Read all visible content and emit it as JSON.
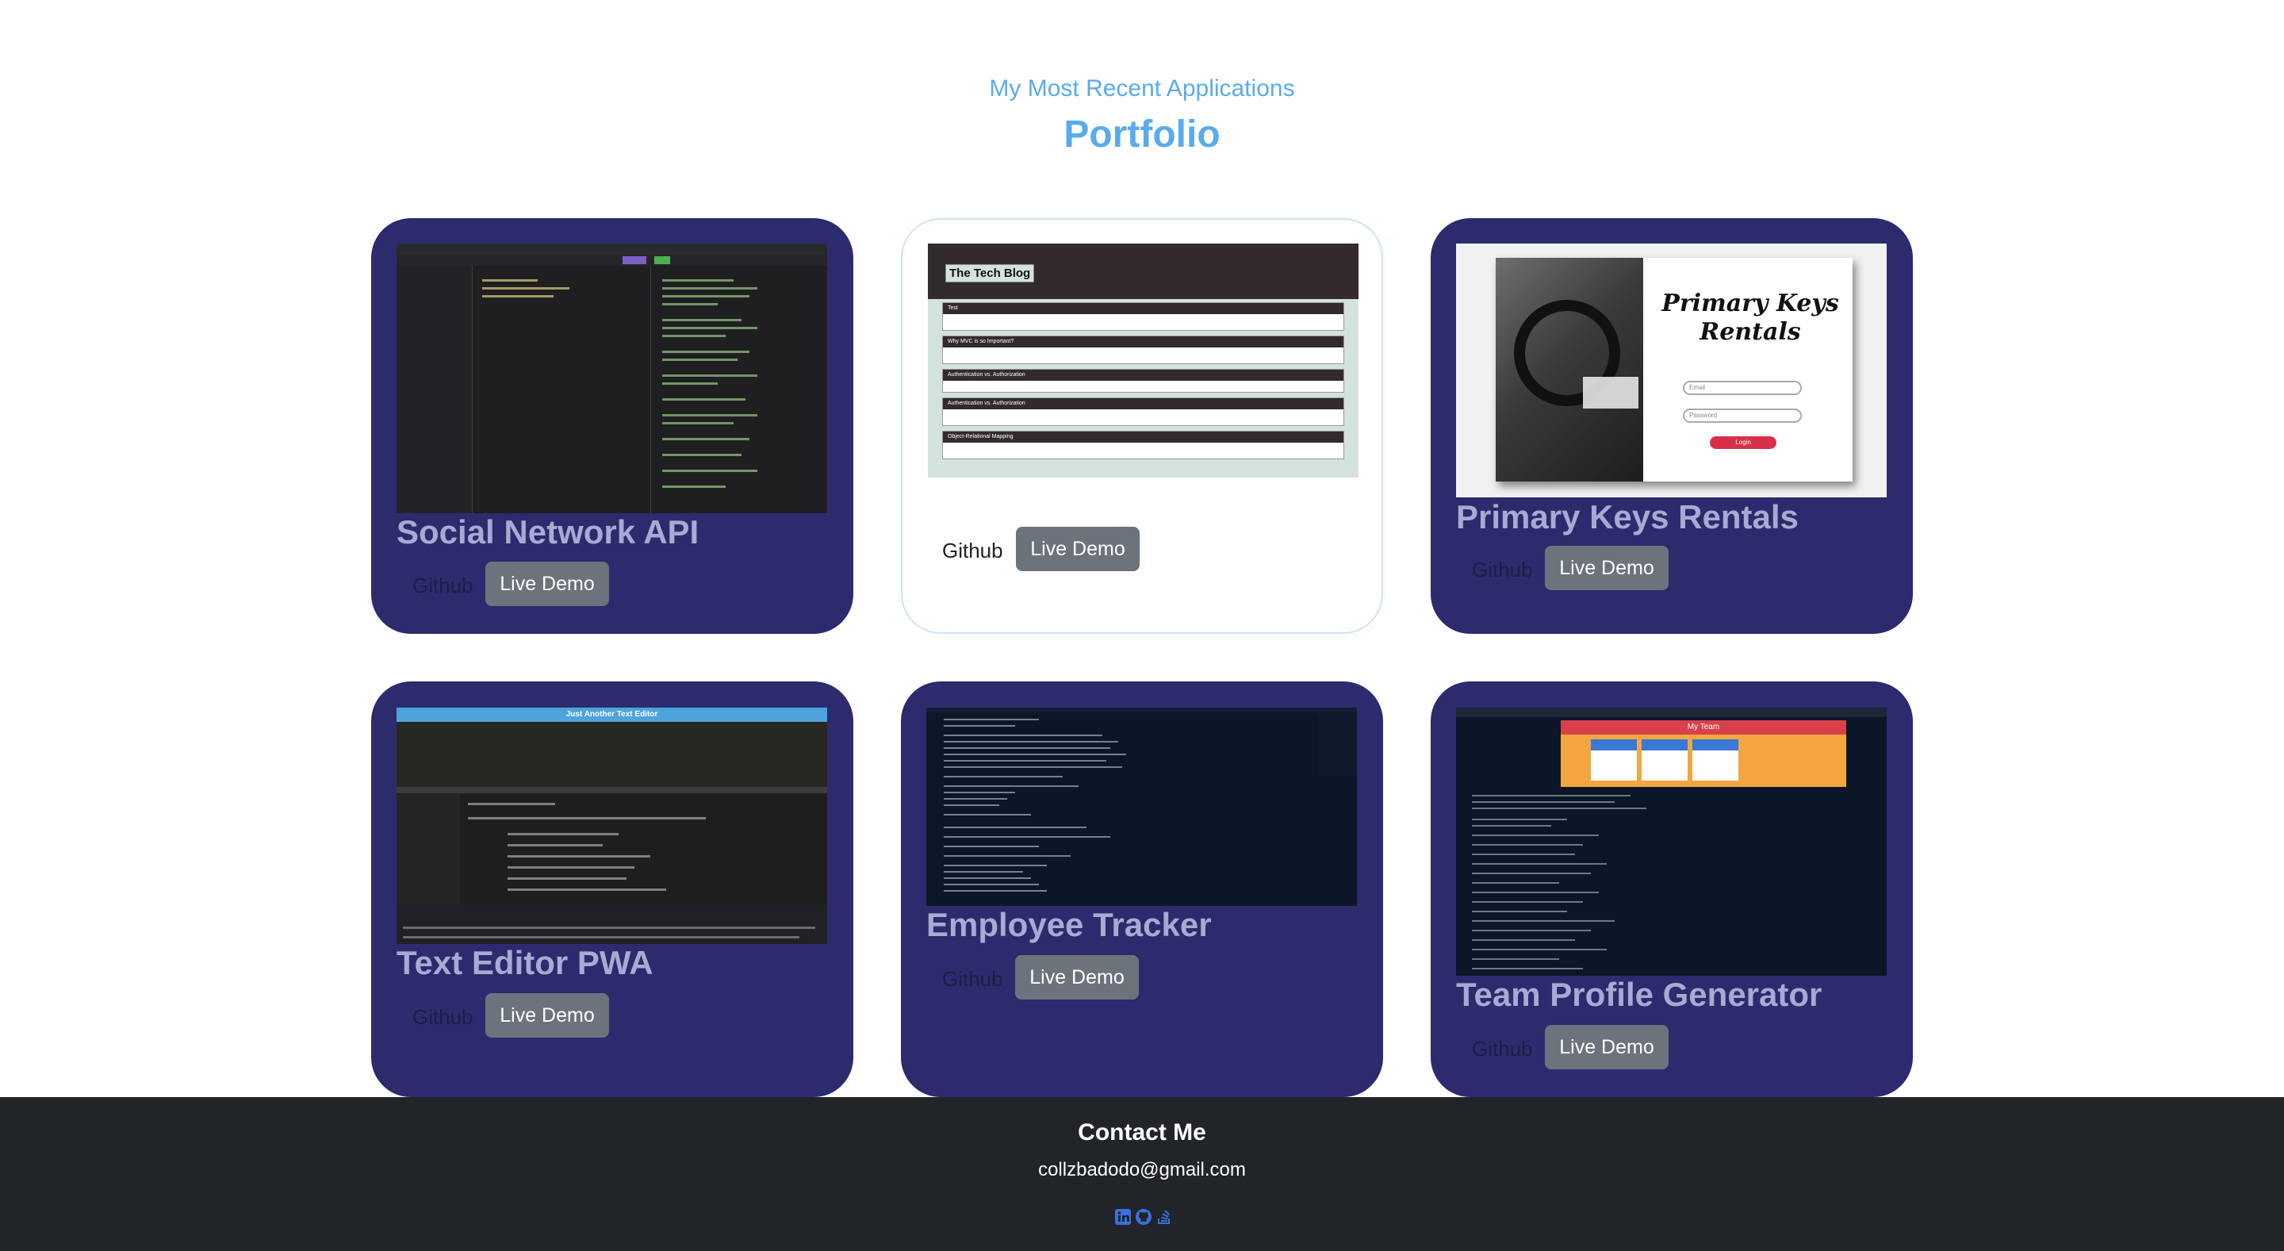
{
  "section": {
    "subtitle": "My Most Recent Applications",
    "title": "Portfolio"
  },
  "projects": [
    {
      "title": "Social Network API",
      "github_label": "Github",
      "demo_label": "Live Demo",
      "screenshot": "Insomnia API client showing JSON responses"
    },
    {
      "title": "",
      "github_label": "Github",
      "demo_label": "Live Demo",
      "screenshot_heading": "The Tech Blog",
      "posts": [
        "Test",
        "Why MVC is so Important?",
        "Authentication vs. Authorization",
        "Authentication vs. Authorization",
        "Object-Relational Mapping"
      ]
    },
    {
      "title": "Primary Keys Rentals",
      "github_label": "Github",
      "demo_label": "Live Demo",
      "screenshot_heading": "Primary Keys Rentals",
      "login_label": "Login",
      "email_placeholder": "Email",
      "password_placeholder": "Password"
    },
    {
      "title": "Text Editor PWA",
      "github_label": "Github",
      "demo_label": "Live Demo",
      "screenshot_heading": "Just Another Text Editor"
    },
    {
      "title": "Employee Tracker",
      "github_label": "Github",
      "demo_label": "Live Demo"
    },
    {
      "title": "Team Profile Generator",
      "github_label": "Github",
      "demo_label": "Live Demo",
      "screenshot_heading": "My Team"
    }
  ],
  "footer": {
    "heading": "Contact Me",
    "email": "collzbadodo@gmail.com",
    "icons": [
      "linkedin-icon",
      "github-icon",
      "stackoverflow-icon"
    ]
  },
  "colors": {
    "accent": "#5aabeb",
    "card_bg": "#2c2b6e",
    "button_bg": "#6c737c",
    "footer_bg": "#212529"
  }
}
